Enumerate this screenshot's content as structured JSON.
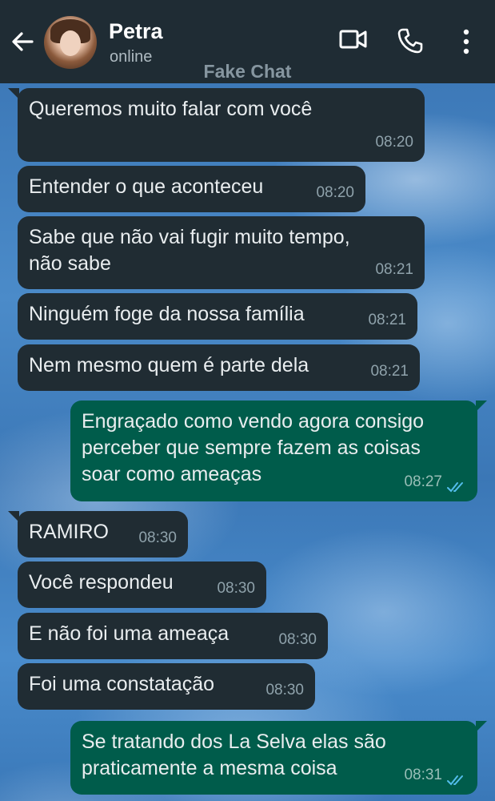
{
  "header": {
    "contact_name": "Petra",
    "status": "online",
    "watermark": "Fake Chat"
  },
  "icons": {
    "back": "arrow-left",
    "video": "video-camera",
    "call": "phone",
    "more": "more-vertical"
  },
  "colors": {
    "header_bg": "#1f2c34",
    "incoming_bubble": "#202c33",
    "outgoing_bubble": "#005c4b",
    "read_ticks": "#53bdeb"
  },
  "messages": [
    {
      "direction": "in",
      "text": "Queremos muito falar com você",
      "time": "08:20"
    },
    {
      "direction": "in",
      "text": "Entender o que aconteceu",
      "time": "08:20"
    },
    {
      "direction": "in",
      "text": "Sabe que não vai fugir muito tempo,\nnão sabe",
      "time": "08:21"
    },
    {
      "direction": "in",
      "text": "Ninguém foge da nossa família",
      "time": "08:21"
    },
    {
      "direction": "in",
      "text": "Nem mesmo quem é parte dela",
      "time": "08:21"
    },
    {
      "direction": "out",
      "text": "Engraçado como vendo agora consigo\nperceber que sempre fazem as coisas\nsoar como ameaças",
      "time": "08:27",
      "status": "read"
    },
    {
      "direction": "in",
      "text": "RAMIRO",
      "time": "08:30"
    },
    {
      "direction": "in",
      "text": "Você respondeu",
      "time": "08:30"
    },
    {
      "direction": "in",
      "text": "E não foi uma ameaça",
      "time": "08:30"
    },
    {
      "direction": "in",
      "text": "Foi uma constatação",
      "time": "08:30"
    },
    {
      "direction": "out",
      "text": "Se tratando dos La Selva elas são\npraticamente a mesma coisa",
      "time": "08:31",
      "status": "read"
    }
  ]
}
